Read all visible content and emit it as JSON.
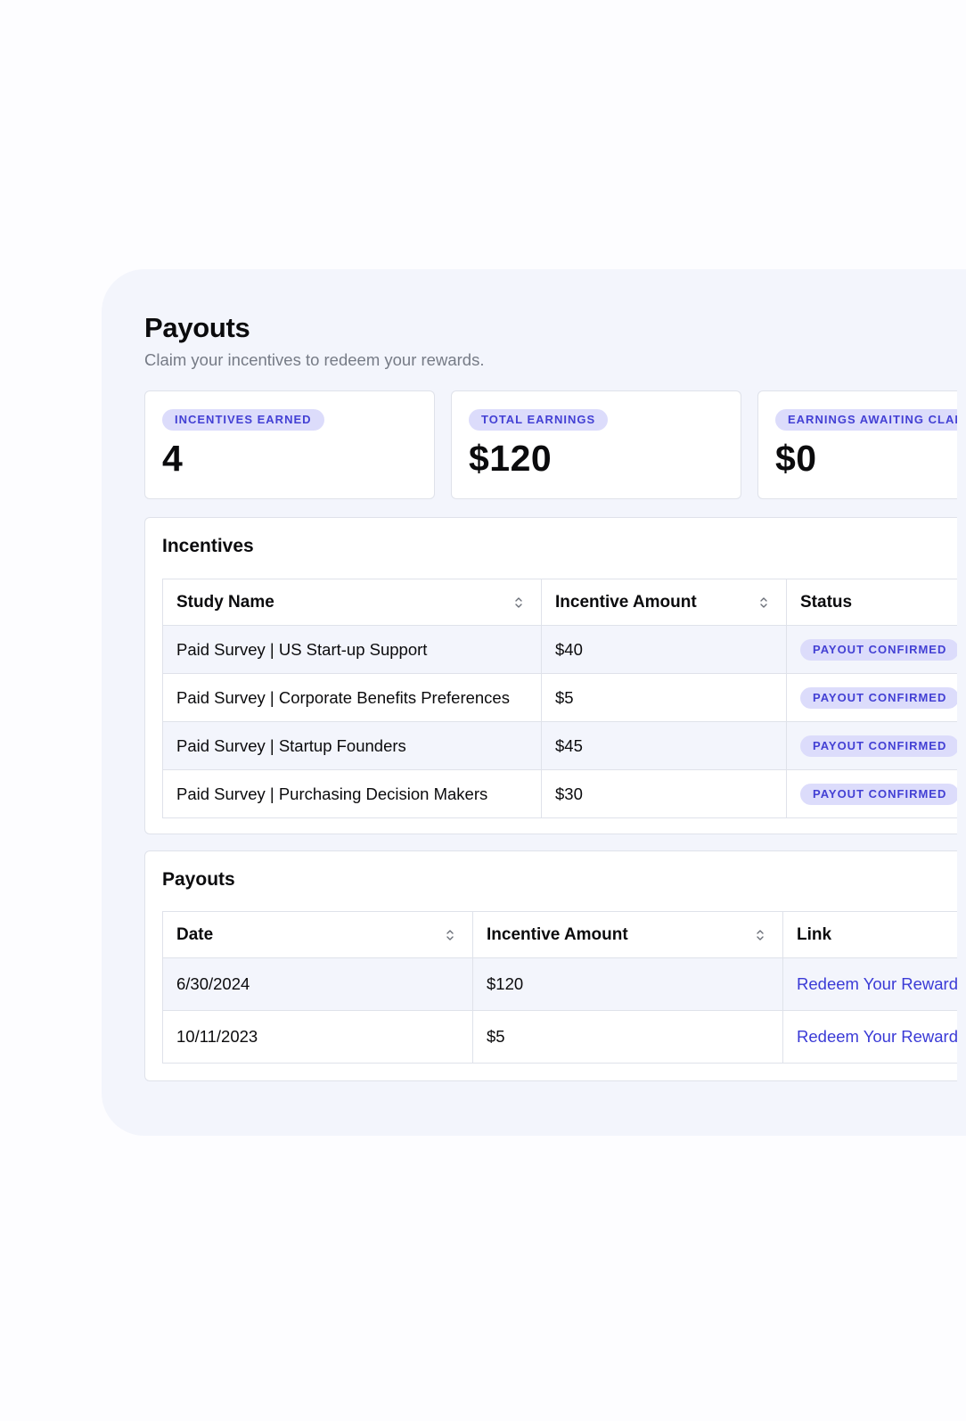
{
  "header": {
    "title": "Payouts",
    "subtitle": "Claim your incentives to redeem your rewards."
  },
  "stats": [
    {
      "label": "INCENTIVES EARNED",
      "value": "4"
    },
    {
      "label": "TOTAL EARNINGS",
      "value": "$120"
    },
    {
      "label": "EARNINGS AWAITING CLAIM",
      "value": "$0"
    }
  ],
  "incentives": {
    "title": "Incentives",
    "columns": [
      "Study Name",
      "Incentive Amount",
      "Status"
    ],
    "rows": [
      {
        "study": "Paid Survey | US Start-up Support",
        "amount": "$40",
        "status": "PAYOUT CONFIRMED"
      },
      {
        "study": "Paid Survey | Corporate Benefits Preferences",
        "amount": "$5",
        "status": "PAYOUT CONFIRMED"
      },
      {
        "study": "Paid Survey | Startup Founders",
        "amount": "$45",
        "status": "PAYOUT CONFIRMED"
      },
      {
        "study": "Paid Survey | Purchasing Decision Makers",
        "amount": "$30",
        "status": "PAYOUT CONFIRMED"
      }
    ]
  },
  "payouts": {
    "title": "Payouts",
    "columns": [
      "Date",
      "Incentive Amount",
      "Link"
    ],
    "rows": [
      {
        "date": "6/30/2024",
        "amount": "$120",
        "link": "Redeem Your Reward"
      },
      {
        "date": "10/11/2023",
        "amount": "$5",
        "link": "Redeem Your Reward"
      }
    ]
  },
  "icons": {
    "sort": "sort-chevrons-icon"
  },
  "colors": {
    "panel_background": "#f3f5fc",
    "badge_background": "#dcdcfb",
    "badge_text": "#4340d4",
    "link": "#3a3ad6",
    "border": "#dfe2ea"
  }
}
